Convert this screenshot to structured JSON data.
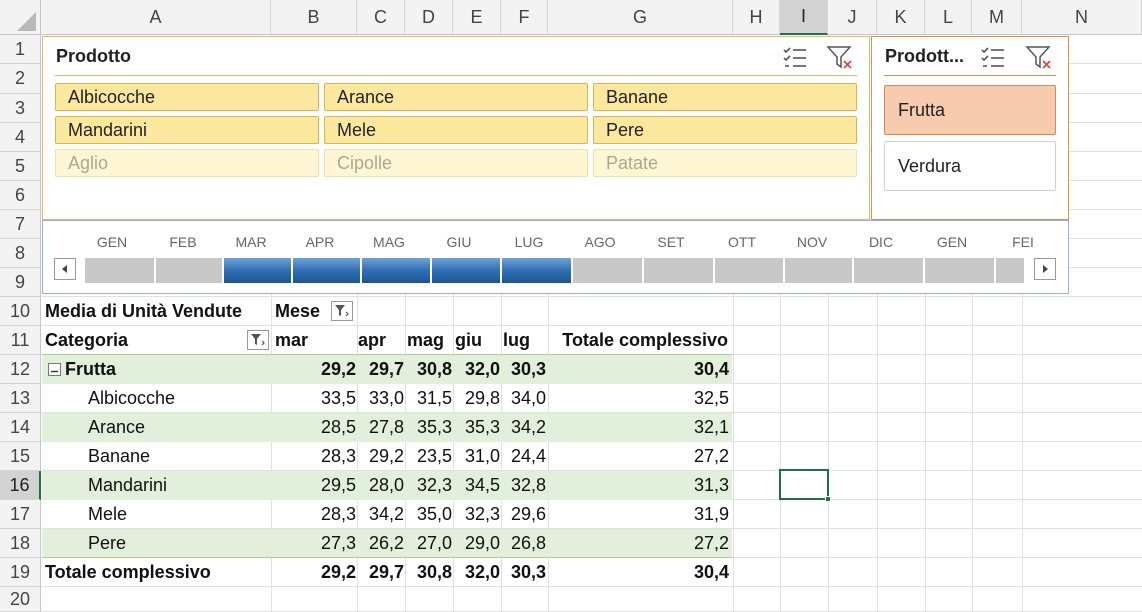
{
  "columns": [
    "A",
    "B",
    "C",
    "D",
    "E",
    "F",
    "G",
    "H",
    "I",
    "J",
    "K",
    "L",
    "M",
    "N"
  ],
  "rows": [
    "1",
    "2",
    "3",
    "4",
    "5",
    "6",
    "7",
    "8",
    "9",
    "10",
    "11",
    "12",
    "13",
    "14",
    "15",
    "16",
    "17",
    "18",
    "19",
    "20"
  ],
  "selected_cell": "I16",
  "slicer_prodotto": {
    "title": "Prodotto",
    "items": [
      {
        "label": "Albicocche",
        "selected": true
      },
      {
        "label": "Arance",
        "selected": true
      },
      {
        "label": "Banane",
        "selected": true
      },
      {
        "label": "Mandarini",
        "selected": true
      },
      {
        "label": "Mele",
        "selected": true
      },
      {
        "label": "Pere",
        "selected": true
      },
      {
        "label": "Aglio",
        "selected": false
      },
      {
        "label": "Cipolle",
        "selected": false
      },
      {
        "label": "Patate",
        "selected": false
      }
    ],
    "icons": [
      "multi-select-icon",
      "clear-filter-icon"
    ]
  },
  "slicer_categoria": {
    "title": "Prodott...",
    "items": [
      {
        "label": "Frutta",
        "selected": true
      },
      {
        "label": "Verdura",
        "selected": false
      }
    ],
    "icons": [
      "multi-select-icon",
      "clear-filter-icon"
    ]
  },
  "timeline": {
    "months": [
      "GEN",
      "FEB",
      "MAR",
      "APR",
      "MAG",
      "GIU",
      "LUG",
      "AGO",
      "SET",
      "OTT",
      "NOV",
      "DIC",
      "GEN",
      "FEI"
    ],
    "selected_range": [
      "MAR",
      "LUG"
    ],
    "icons": [
      "scroll-left-icon",
      "scroll-right-icon"
    ]
  },
  "pivot": {
    "value_label": "Media di Unità Vendute",
    "column_field": "Mese",
    "row_field": "Categoria",
    "column_headers": [
      "mar",
      "apr",
      "mag",
      "giu",
      "lug",
      "Totale complessivo"
    ],
    "group": {
      "label": "Frutta",
      "values": [
        "29,2",
        "29,7",
        "30,8",
        "32,0",
        "30,3",
        "30,4"
      ]
    },
    "rows": [
      {
        "label": "Albicocche",
        "values": [
          "33,5",
          "33,0",
          "31,5",
          "29,8",
          "34,0",
          "32,5"
        ]
      },
      {
        "label": "Arance",
        "values": [
          "28,5",
          "27,8",
          "35,3",
          "35,3",
          "34,2",
          "32,1"
        ]
      },
      {
        "label": "Banane",
        "values": [
          "28,3",
          "29,2",
          "23,5",
          "31,0",
          "24,4",
          "27,2"
        ]
      },
      {
        "label": "Mandarini",
        "values": [
          "29,5",
          "28,0",
          "32,3",
          "34,5",
          "32,8",
          "31,3"
        ]
      },
      {
        "label": "Mele",
        "values": [
          "28,3",
          "34,2",
          "35,0",
          "32,3",
          "29,6",
          "31,9"
        ]
      },
      {
        "label": "Pere",
        "values": [
          "27,3",
          "26,2",
          "27,0",
          "29,0",
          "26,8",
          "27,2"
        ]
      }
    ],
    "grand_total": {
      "label": "Totale complessivo",
      "values": [
        "29,2",
        "29,7",
        "30,8",
        "32,0",
        "30,3",
        "30,4"
      ]
    }
  },
  "colors": {
    "accent": "#1e7145",
    "slicer_selected": "#fde8a0",
    "category_selected": "#f7cbad",
    "timeline_selected": "#2f6fb4",
    "band": "#e2efda"
  }
}
